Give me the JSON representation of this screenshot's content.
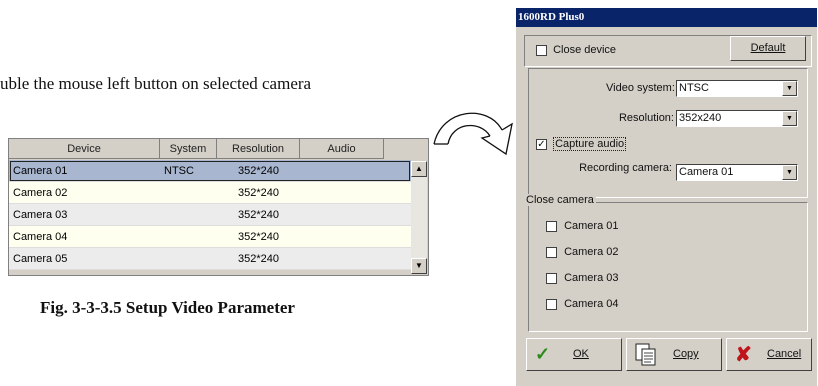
{
  "instruction": "uble the mouse left button on selected camera",
  "figure_caption": "Fig. 3-3-3.5 Setup Video Parameter",
  "table": {
    "columns": [
      "Device",
      "System",
      "Resolution",
      "Audio"
    ],
    "rows": [
      {
        "device": "Camera 01",
        "system": "NTSC",
        "resolution": "352*240",
        "selected": true
      },
      {
        "device": "Camera 02",
        "system": "",
        "resolution": "352*240"
      },
      {
        "device": "Camera 03",
        "system": "",
        "resolution": "352*240"
      },
      {
        "device": "Camera 04",
        "system": "",
        "resolution": "352*240"
      },
      {
        "device": "Camera 05",
        "system": "",
        "resolution": "352*240"
      }
    ]
  },
  "dialog": {
    "title": "1600RD Plus0",
    "close_device_label": "Close device",
    "default_button": "Default",
    "video_system_label": "Video system:",
    "video_system_value": "NTSC",
    "resolution_label": "Resolution:",
    "resolution_value": "352x240",
    "capture_audio_label": "Capture audio",
    "recording_camera_label": "Recording camera:",
    "recording_camera_value": "Camera 01",
    "close_camera_group": "Close camera",
    "cameras": [
      "Camera 01",
      "Camera 02",
      "Camera 03",
      "Camera 04"
    ],
    "ok_button": "OK",
    "copy_button": "Copy",
    "cancel_button": "Cancel"
  },
  "colors": {
    "title_bar": "#0a246a",
    "selection": "#a9b6cf",
    "row_odd": "#fffff0",
    "window_bg": "#d4d0c8"
  }
}
